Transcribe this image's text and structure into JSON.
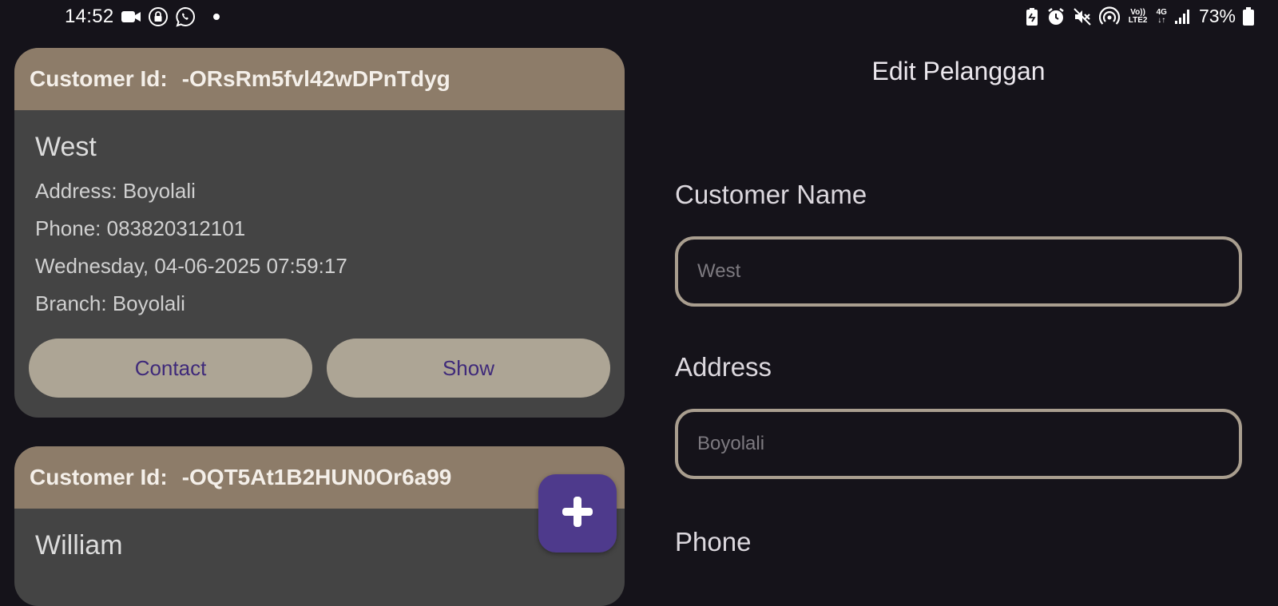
{
  "status_bar": {
    "time": "14:52",
    "battery": "73%",
    "volte": "Vo)) LTE2",
    "network": "4G"
  },
  "customers": [
    {
      "id_label": "Customer Id:",
      "id": "-ORsRm5fvl42wDPnTdyg",
      "name": "West",
      "address": "Address: Boyolali",
      "phone": "Phone: 083820312101",
      "datetime": "Wednesday, 04-06-2025 07:59:17",
      "branch": "Branch: Boyolali",
      "contact_label": "Contact",
      "show_label": "Show"
    },
    {
      "id_label": "Customer Id:",
      "id": "-OQT5At1B2HUN0Or6a99",
      "name": "William"
    }
  ],
  "form": {
    "title": "Edit Pelanggan",
    "name_label": "Customer Name",
    "name_placeholder": "West",
    "address_label": "Address",
    "address_placeholder": "Boyolali",
    "phone_label": "Phone"
  },
  "colors": {
    "background": "#15131a",
    "card_header": "#8d7c69",
    "card_body": "#444444",
    "button": "#ada595",
    "button_text": "#3f2a7a",
    "fab": "#4e3a8c",
    "input_border": "#a99e8f"
  }
}
